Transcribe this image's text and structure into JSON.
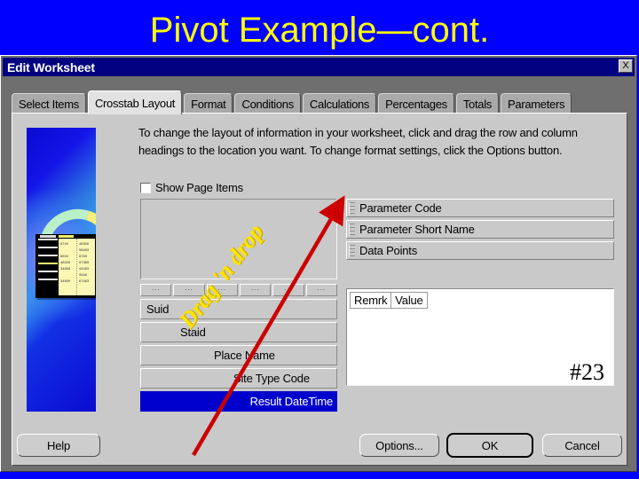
{
  "slide": {
    "title": "Pivot Example—cont.",
    "number": "#23",
    "background_color": "#0000FF",
    "title_color": "#FFFF00"
  },
  "dialog": {
    "title": "Edit Worksheet",
    "close_icon": "✕",
    "close_label": "X",
    "tabs": [
      {
        "label": "Select Items",
        "active": false
      },
      {
        "label": "Crosstab Layout",
        "active": true
      },
      {
        "label": "Format",
        "active": false
      },
      {
        "label": "Conditions",
        "active": false
      },
      {
        "label": "Calculations",
        "active": false
      },
      {
        "label": "Percentages",
        "active": false
      },
      {
        "label": "Totals",
        "active": false
      },
      {
        "label": "Parameters",
        "active": false
      }
    ],
    "instructions": "To change the layout of information in your worksheet, click and drag the row and column headings to the location you want.  To change format settings, click the Options button.",
    "show_page_items": {
      "label": "Show Page Items",
      "checked": false
    },
    "column_headings": [
      "Parameter Code",
      "Parameter Short Name",
      "Data Points"
    ],
    "ellipsis_cells": [
      "...",
      "...",
      "...",
      "...",
      "...",
      "..."
    ],
    "row_headings": [
      {
        "label": "Suid",
        "indent": 0,
        "selected": false
      },
      {
        "label": "Staid",
        "indent": 1,
        "selected": false
      },
      {
        "label": "Place Name",
        "indent": 2,
        "selected": false
      },
      {
        "label": "Site Type Code",
        "indent": 3,
        "selected": false
      },
      {
        "label": "Result DateTime",
        "indent": 4,
        "selected": true
      }
    ],
    "data_pane_headers": [
      "Remrk",
      "Value"
    ],
    "buttons": {
      "help": "Help",
      "options": "Options...",
      "ok": "OK",
      "cancel": "Cancel"
    }
  },
  "annotation": {
    "drag_drop_label": "Drag 'n drop",
    "arrow_color": "#CC0000",
    "label_color": "#FFE400"
  },
  "pivot_graphic": {
    "left_column": [
      "6749",
      "",
      "8543",
      "48305",
      "34858",
      "",
      "34509"
    ],
    "right_column": [
      "48306",
      "58483",
      "8789",
      "57389",
      "44483",
      "9648",
      "67483"
    ]
  }
}
